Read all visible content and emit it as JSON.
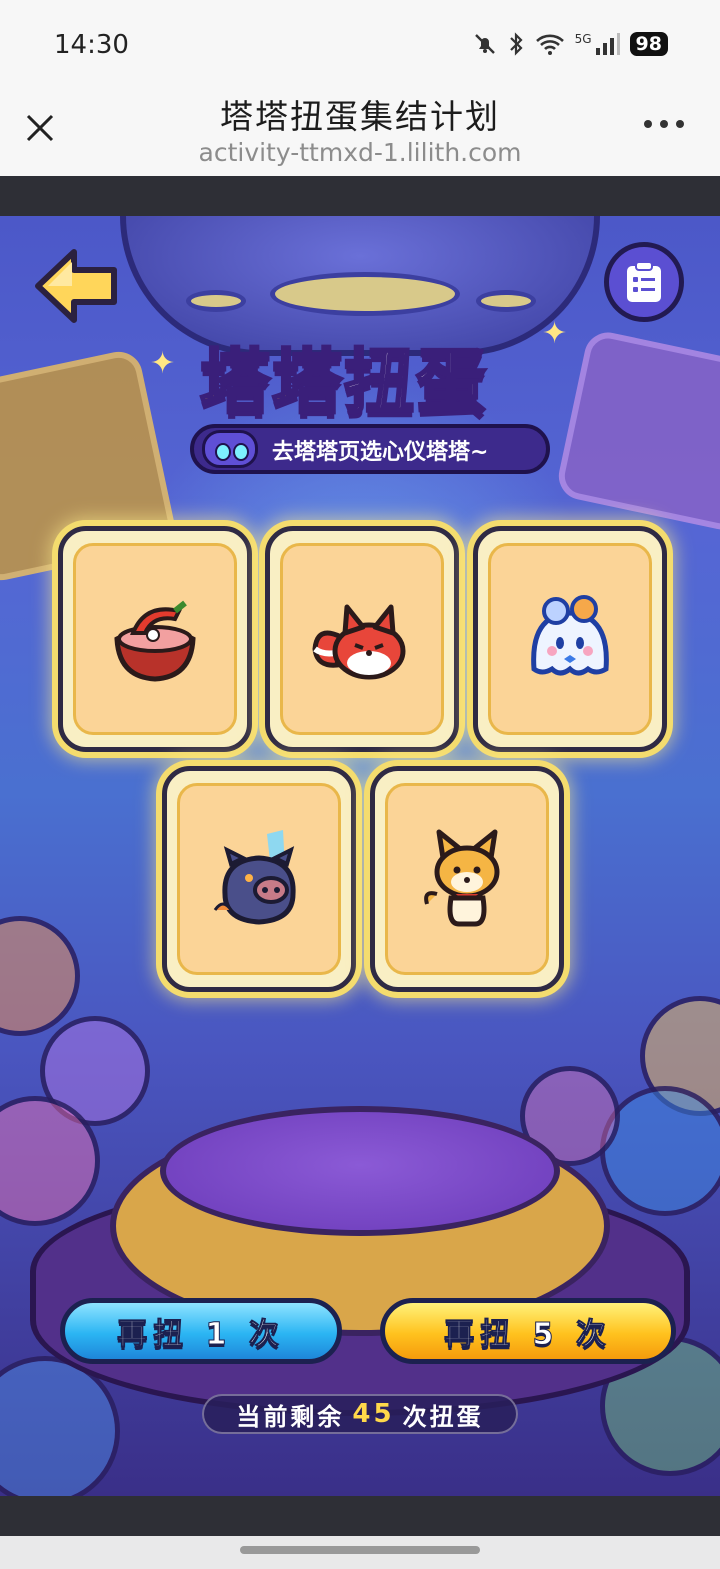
{
  "status_bar": {
    "time": "14:30",
    "network": "5G",
    "battery": "98",
    "icons": [
      "mute-icon",
      "bluetooth-icon",
      "wifi-icon",
      "signal-icon",
      "battery-icon"
    ]
  },
  "browser": {
    "title": "塔塔扭蛋集结计划",
    "url": "activity-ttmxd-1.lilith.com",
    "close_icon": "close-icon",
    "more_icon": "more-icon"
  },
  "game": {
    "logo_title_part1": "塔塔",
    "logo_title_part2": "扭蛋",
    "logo_subtitle": "去塔塔页选心仪塔塔~",
    "back_icon": "back-arrow-icon",
    "record_icon": "record-list-icon",
    "cards": [
      {
        "name": "reward-card-chili-bowl",
        "icon": "chili-bowl-icon"
      },
      {
        "name": "reward-card-red-fox",
        "icon": "red-fox-icon"
      },
      {
        "name": "reward-card-ghost-bunny",
        "icon": "ghost-bunny-icon"
      },
      {
        "name": "reward-card-boar",
        "icon": "boar-icon"
      },
      {
        "name": "reward-card-shiba",
        "icon": "shiba-icon"
      }
    ],
    "spin_once_label": "再扭 1 次",
    "spin_five_label": "再扭 5 次",
    "remaining_prefix": "当前剩余",
    "remaining_count": "45",
    "remaining_suffix": "次扭蛋"
  },
  "colors": {
    "accent_yellow": "#ffd84a",
    "button_blue": "#2bb5f3",
    "button_gold": "#ffc21e",
    "card_bg": "#fbd497"
  }
}
